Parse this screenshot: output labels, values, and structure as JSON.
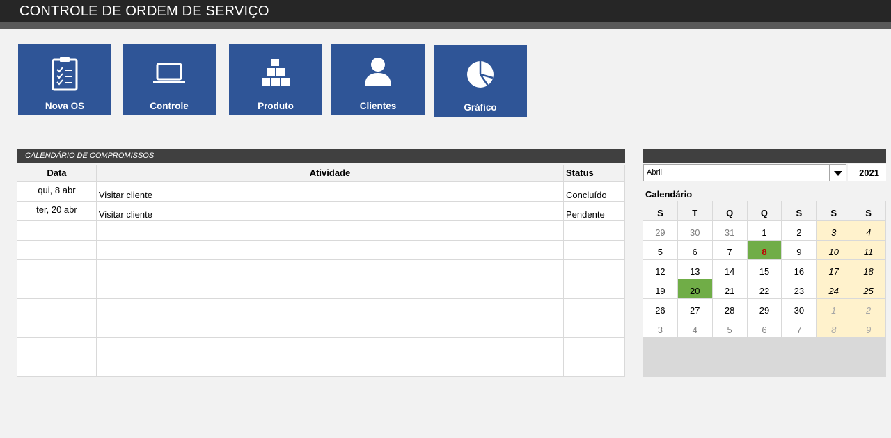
{
  "header": {
    "title": "CONTROLE DE ORDEM DE SERVIÇO"
  },
  "nav": [
    {
      "label": "Nova OS",
      "icon": "clipboard-checklist-icon"
    },
    {
      "label": "Controle",
      "icon": "laptop-icon"
    },
    {
      "label": "Produto",
      "icon": "boxes-stack-icon"
    },
    {
      "label": "Clientes",
      "icon": "user-icon"
    },
    {
      "label": "Gráfico",
      "icon": "pie-chart-icon"
    }
  ],
  "agenda": {
    "title": "CALENDÁRIO DE COMPROMISSOS",
    "columns": [
      "Data",
      "Atividade",
      "Status"
    ],
    "rows": [
      {
        "data": "qui, 8 abr",
        "atividade": "Visitar cliente",
        "status": "Concluído"
      },
      {
        "data": "ter, 20 abr",
        "atividade": "Visitar cliente",
        "status": "Pendente"
      }
    ],
    "empty_rows": 8
  },
  "calendar": {
    "month": "Abril",
    "year": "2021",
    "label": "Calendário",
    "weekdays": [
      "S",
      "T",
      "Q",
      "Q",
      "S",
      "S",
      "S"
    ],
    "weeks": [
      [
        "29",
        "30",
        "31",
        "1",
        "2",
        "3",
        "4"
      ],
      [
        "5",
        "6",
        "7",
        "8",
        "9",
        "10",
        "11"
      ],
      [
        "12",
        "13",
        "14",
        "15",
        "16",
        "17",
        "18"
      ],
      [
        "19",
        "20",
        "21",
        "22",
        "23",
        "24",
        "25"
      ],
      [
        "26",
        "27",
        "28",
        "29",
        "30",
        "1",
        "2"
      ],
      [
        "3",
        "4",
        "5",
        "6",
        "7",
        "8",
        "9"
      ]
    ],
    "event_days": [
      "8",
      "20"
    ],
    "colors": {
      "event": "#70ad47",
      "weekend": "#fff2cc",
      "nav_button": "#2f5597"
    }
  }
}
